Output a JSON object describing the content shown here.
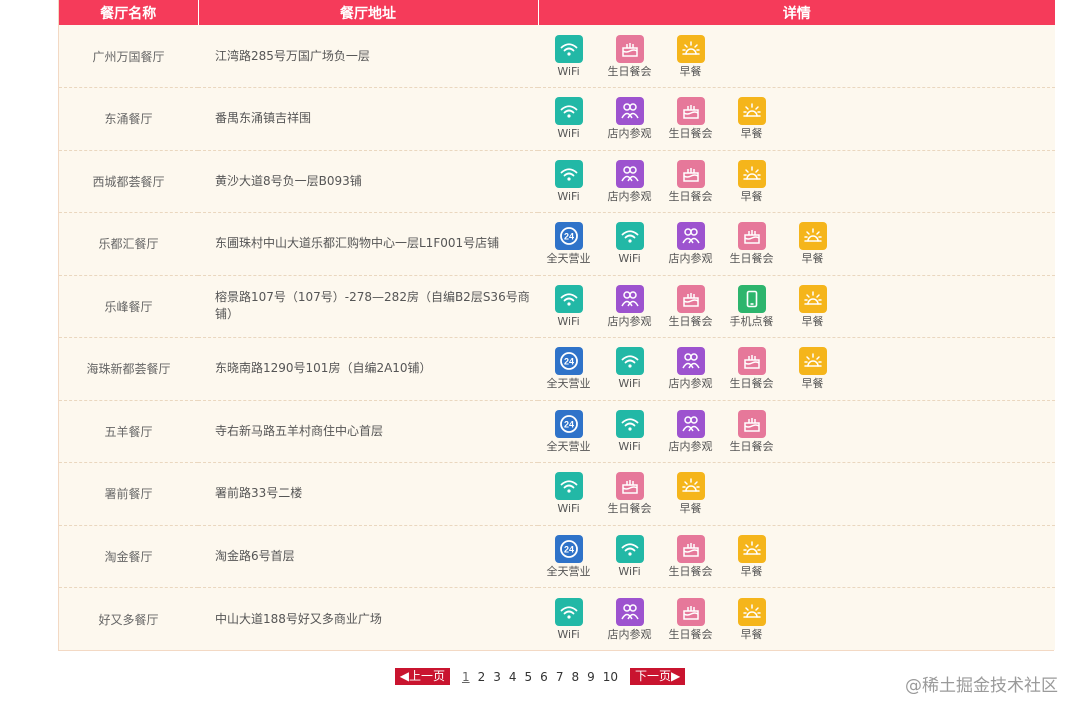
{
  "table": {
    "headers": [
      "餐厅名称",
      "餐厅地址",
      "详情"
    ],
    "rows": [
      {
        "name": "广州万国餐厅",
        "address": "江湾路285号万国广场负一层",
        "features": [
          "wifi",
          "birthday",
          "breakfast"
        ]
      },
      {
        "name": "东涌餐厅",
        "address": "番禺东涌镇吉祥围",
        "features": [
          "wifi",
          "visit",
          "birthday",
          "breakfast"
        ]
      },
      {
        "name": "西城都荟餐厅",
        "address": "黄沙大道8号负一层B093铺",
        "features": [
          "wifi",
          "visit",
          "birthday",
          "breakfast"
        ]
      },
      {
        "name": "乐都汇餐厅",
        "address": "东圃珠村中山大道乐都汇购物中心一层L1F001号店铺",
        "features": [
          "h24",
          "wifi",
          "visit",
          "birthday",
          "breakfast"
        ]
      },
      {
        "name": "乐峰餐厅",
        "address": "榕景路107号（107号）-278—282房（自编B2层S36号商铺）",
        "features": [
          "wifi",
          "visit",
          "birthday",
          "mobile",
          "breakfast"
        ]
      },
      {
        "name": "海珠新都荟餐厅",
        "address": "东晓南路1290号101房（自编2A10铺）",
        "features": [
          "h24",
          "wifi",
          "visit",
          "birthday",
          "breakfast"
        ]
      },
      {
        "name": "五羊餐厅",
        "address": "寺右新马路五羊村商住中心首层",
        "features": [
          "h24",
          "wifi",
          "visit",
          "birthday"
        ]
      },
      {
        "name": "署前餐厅",
        "address": "署前路33号二楼",
        "features": [
          "wifi",
          "birthday",
          "breakfast"
        ]
      },
      {
        "name": "淘金餐厅",
        "address": "淘金路6号首层",
        "features": [
          "h24",
          "wifi",
          "birthday",
          "breakfast"
        ]
      },
      {
        "name": "好又多餐厅",
        "address": "中山大道188号好又多商业广场",
        "features": [
          "wifi",
          "visit",
          "birthday",
          "breakfast"
        ]
      }
    ]
  },
  "features": {
    "h24": {
      "label": "全天营业",
      "icon": "24h-icon",
      "color": "#2f73c9"
    },
    "wifi": {
      "label": "WiFi",
      "icon": "wifi-icon",
      "color": "#22b8a6"
    },
    "visit": {
      "label": "店内参观",
      "icon": "people-icon",
      "color": "#9d53cf"
    },
    "birthday": {
      "label": "生日餐会",
      "icon": "cake-icon",
      "color": "#e6789a"
    },
    "mobile": {
      "label": "手机点餐",
      "icon": "phone-icon",
      "color": "#2db56d"
    },
    "breakfast": {
      "label": "早餐",
      "icon": "sunrise-icon",
      "color": "#f5b51b"
    }
  },
  "pager": {
    "prev": "◀上一页",
    "next": "下一页▶",
    "pages": [
      "1",
      "2",
      "3",
      "4",
      "5",
      "6",
      "7",
      "8",
      "9",
      "10"
    ],
    "current": "1"
  },
  "watermark": "@稀土掘金技术社区"
}
